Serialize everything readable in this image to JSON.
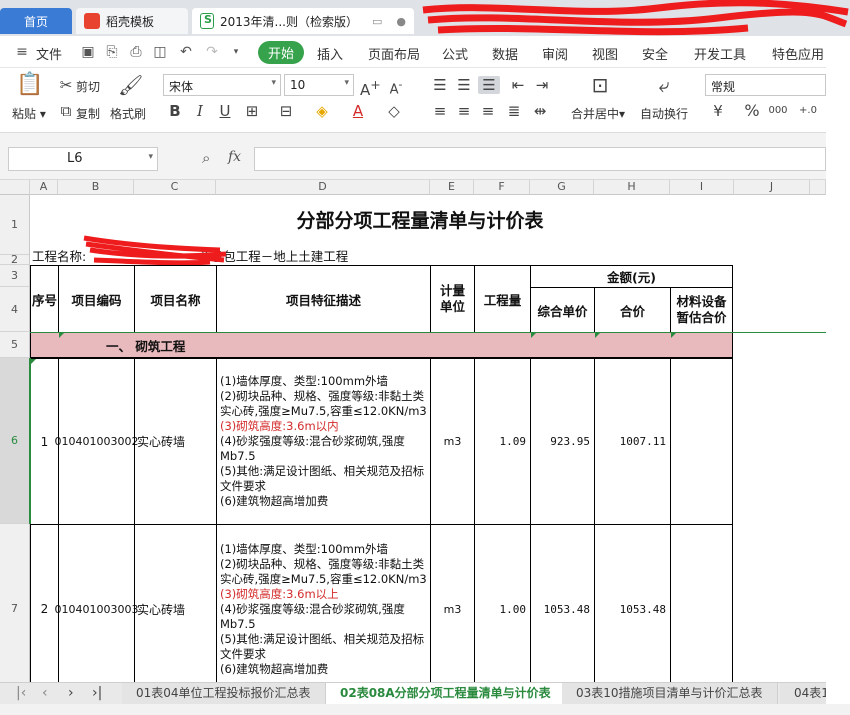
{
  "tabs": {
    "home": "首页",
    "daoke": "稻壳模板",
    "doc": "2013年清...则（检索版）"
  },
  "menu": {
    "file": "文件",
    "start": "开始",
    "insert": "插入",
    "layout": "页面布局",
    "formula": "公式",
    "data": "数据",
    "review": "审阅",
    "view": "视图",
    "security": "安全",
    "dev": "开发工具",
    "special": "特色应用"
  },
  "ribbon": {
    "paste": "粘贴",
    "cut": "剪切",
    "copy": "复制",
    "format_painter": "格式刷",
    "font_name": "宋体",
    "font_size": "10",
    "merge_center": "合并居中",
    "wrap_text": "自动换行",
    "number_format": "常规",
    "grow": "A",
    "shrink": "A",
    "bold": "B",
    "italic": "I",
    "underline": "U",
    "percent": "%",
    "thousands": "000"
  },
  "formula_bar": {
    "name_box": "L6",
    "fx": "fx",
    "value": ""
  },
  "columns": [
    "A",
    "B",
    "C",
    "D",
    "E",
    "F",
    "G",
    "H",
    "I",
    "J"
  ],
  "rows": [
    "1",
    "2",
    "3",
    "4",
    "5",
    "6",
    "7"
  ],
  "sheet": {
    "title": "分部分项工程量清单与计价表",
    "project_label": "工程名称:",
    "project_suffix": "总承包工程－地上土建工程",
    "headers": {
      "seq": "序号",
      "code": "项目编码",
      "name": "项目名称",
      "desc": "项目特征描述",
      "unit": "计量单位",
      "qty": "工程量",
      "amount": "金额(元)",
      "unit_price": "综合单价",
      "total": "合价",
      "material": "材料设备暂估合价"
    },
    "section": "一、 砌筑工程",
    "items": [
      {
        "seq": "1",
        "code": "010401003002",
        "name": "实心砖墙",
        "desc": [
          "(1)墙体厚度、类型:100mm外墙",
          "(2)砌块品种、规格、强度等级:非黏土类实心砖,强度≥Mu7.5,容重≤12.0KN/m3",
          "(3)砌筑高度:3.6m以内",
          "(4)砂浆强度等级:混合砂浆砌筑,强度Mb7.5",
          "(5)其他:满足设计图纸、相关规范及招标文件要求",
          "(6)建筑物超高增加费"
        ],
        "unit": "m3",
        "qty": "1.09",
        "unit_price": "923.95",
        "total": "1007.11"
      },
      {
        "seq": "2",
        "code": "010401003003",
        "name": "实心砖墙",
        "desc": [
          "(1)墙体厚度、类型:100mm外墙",
          "(2)砌块品种、规格、强度等级:非黏土类实心砖,强度≥Mu7.5,容重≤12.0KN/m3",
          "(3)砌筑高度:3.6m以上",
          "(4)砂浆强度等级:混合砂浆砌筑,强度Mb7.5",
          "(5)其他:满足设计图纸、相关规范及招标文件要求",
          "(6)建筑物超高增加费"
        ],
        "unit": "m3",
        "qty": "1.00",
        "unit_price": "1053.48",
        "total": "1053.48"
      }
    ]
  },
  "sheet_tabs": [
    "01表04单位工程投标报价汇总表",
    "02表08A分部分项工程量清单与计价表",
    "03表10措施项目清单与计价汇总表",
    "04表1"
  ],
  "colors": {
    "accent_green": "#36a24b",
    "header_pink": "#e8b9bd",
    "home_blue": "#3a7bd5"
  }
}
